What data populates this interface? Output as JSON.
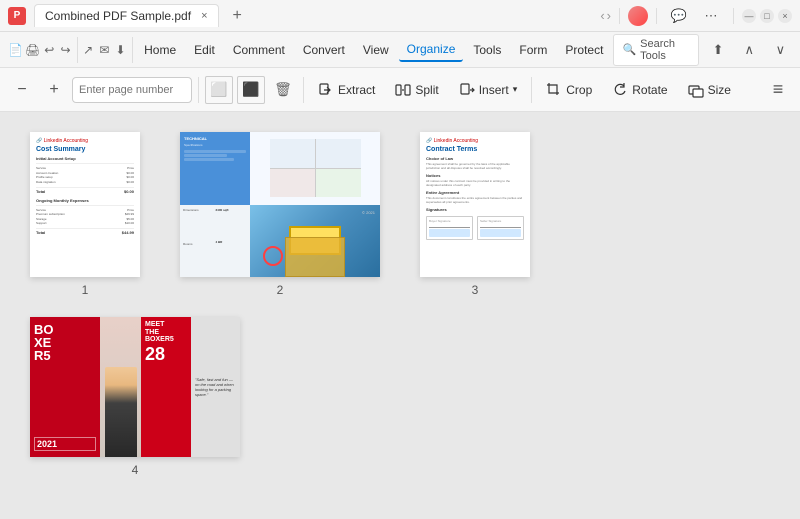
{
  "titleBar": {
    "appName": "Combined PDF Sample.pdf",
    "closeLabel": "×",
    "newTabLabel": "+",
    "minimizeLabel": "—",
    "maximizeLabel": "□",
    "windowCloseLabel": "×"
  },
  "menuBar": {
    "items": [
      {
        "label": "File",
        "active": false
      },
      {
        "label": "Home",
        "active": false
      },
      {
        "label": "Edit",
        "active": false
      },
      {
        "label": "Comment",
        "active": false
      },
      {
        "label": "Convert",
        "active": false
      },
      {
        "label": "View",
        "active": false
      },
      {
        "label": "Organize",
        "active": true
      },
      {
        "label": "Tools",
        "active": false
      },
      {
        "label": "Form",
        "active": false
      },
      {
        "label": "Protect",
        "active": false
      }
    ],
    "searchPlaceholder": "Search Tools"
  },
  "toolbar": {
    "zoomOutLabel": "−",
    "zoomInLabel": "+",
    "pageInputPlaceholder": "Enter page number",
    "tools": [
      {
        "label": "Extract",
        "icon": "extract"
      },
      {
        "label": "Split",
        "icon": "split"
      },
      {
        "label": "Insert",
        "icon": "insert"
      },
      {
        "label": "Crop",
        "icon": "crop"
      },
      {
        "label": "Rotate",
        "icon": "rotate"
      },
      {
        "label": "Size",
        "icon": "size"
      }
    ],
    "moreLabel": "≡"
  },
  "pages": [
    {
      "number": "1",
      "type": "cost-summary",
      "title": "Cost Summary",
      "brand": "Linkedin Accounting"
    },
    {
      "number": "2",
      "type": "architecture"
    },
    {
      "number": "3",
      "type": "contract-terms",
      "title": "Contract Terms",
      "brand": "Linkedin Accounting"
    },
    {
      "number": "4",
      "type": "boxer",
      "headline": "MEET THE BOXER5",
      "year": "2021",
      "boxerLabel": "BOXER5"
    }
  ]
}
